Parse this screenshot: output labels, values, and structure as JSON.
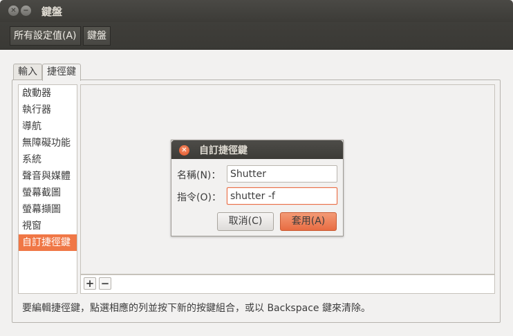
{
  "window": {
    "title": "鍵盤"
  },
  "menubar": {
    "items": [
      "所有設定值(A)",
      "鍵盤"
    ]
  },
  "tabs": [
    "輸入",
    "捷徑鍵"
  ],
  "sidebar": {
    "items": [
      "啟動器",
      "執行器",
      "導航",
      "無障礙功能",
      "系統",
      "聲音與媒體",
      "螢幕截圖",
      "螢幕擷圖",
      "視窗",
      "自訂捷徑鍵"
    ],
    "selected_index": 9
  },
  "toolbar": {
    "add": "+",
    "remove": "−"
  },
  "hint": "要編輯捷徑鍵，點選相應的列並按下新的按鍵組合，或以 Backspace 鍵來清除。",
  "dialog": {
    "title": "自訂捷徑鍵",
    "name_label": "名稱(N)：",
    "name_value": "Shutter",
    "command_label": "指令(O)：",
    "command_value": "shutter -f",
    "cancel_label": "取消(C)",
    "apply_label": "套用(A)"
  },
  "colors": {
    "accent": "#f07746",
    "titlebar": "#3c3b37"
  }
}
